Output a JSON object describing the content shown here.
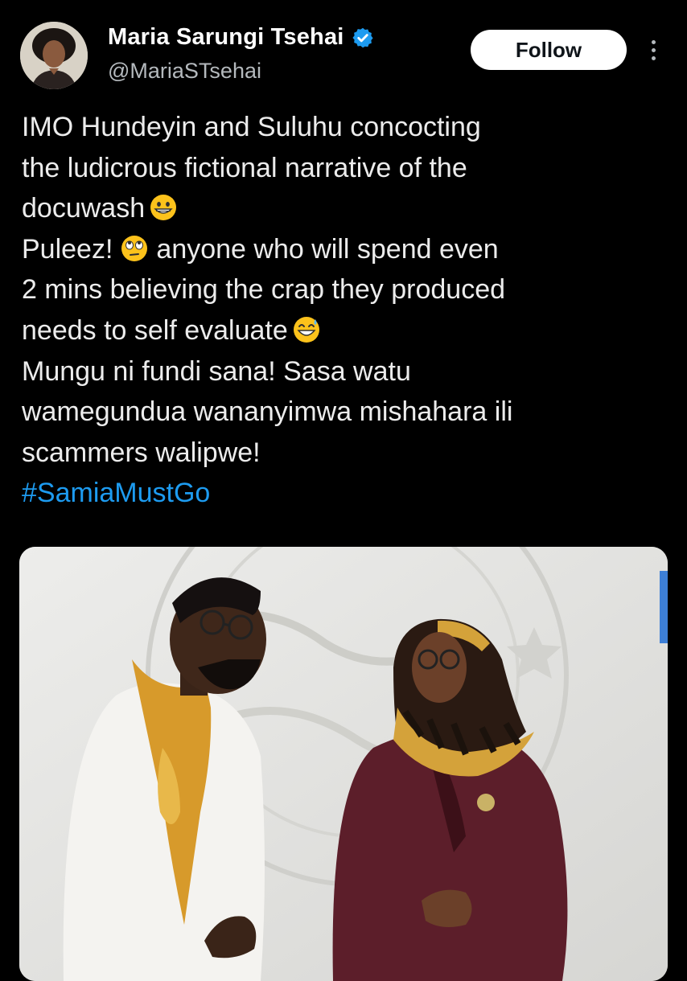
{
  "author": {
    "display_name": "Maria Sarungi Tsehai",
    "handle": "@MariaSTsehai",
    "verified": true
  },
  "actions": {
    "follow_label": "Follow"
  },
  "tweet": {
    "lines": [
      "IMO Hundeyin and Suluhu concocting",
      "the ludicrous fictional narrative of the",
      "docuwash",
      "Puleez!",
      "anyone who will spend even",
      "2 mins believing the crap they produced",
      "needs to self evaluate",
      "Mungu ni fundi sana! Sasa watu",
      "wamegundua wananyimwa mishahara ili",
      "scammers walipwe!"
    ],
    "hashtag": "#SamiaMustGo",
    "emojis": [
      "grinning-face-icon",
      "rolling-eyes-icon",
      "grinning-sweat-icon"
    ]
  },
  "colors": {
    "background": "#000000",
    "link": "#1d9bf0",
    "verified_badge": "#1d9bf0",
    "follow_button_bg": "#ffffff"
  }
}
